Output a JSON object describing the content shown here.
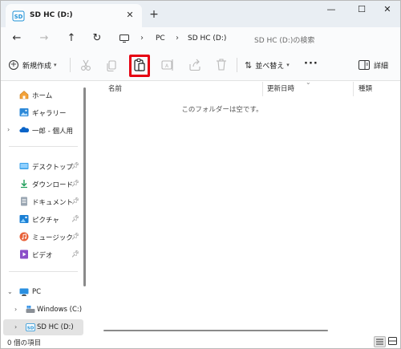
{
  "window": {
    "tab_title": "SD HC (D:)",
    "tab_icon_text": "SD"
  },
  "address_bar": {
    "segments": [
      "PC",
      "SD HC (D:)"
    ],
    "search_placeholder": "SD HC (D:)の検索"
  },
  "command_bar": {
    "new_label": "新規作成",
    "sort_label": "並べ替え",
    "details_label": "詳細"
  },
  "nav_pane": {
    "items": [
      {
        "label": "ホーム",
        "icon": "home-icon"
      },
      {
        "label": "ギャラリー",
        "icon": "gallery-icon"
      },
      {
        "label": "一郎 - 個人用",
        "icon": "onedrive-icon"
      },
      {
        "label": "デスクトップ",
        "icon": "desktop-icon"
      },
      {
        "label": "ダウンロード",
        "icon": "download-icon"
      },
      {
        "label": "ドキュメント",
        "icon": "documents-icon"
      },
      {
        "label": "ピクチャ",
        "icon": "pictures-icon"
      },
      {
        "label": "ミュージック",
        "icon": "music-icon"
      },
      {
        "label": "ビデオ",
        "icon": "videos-icon"
      },
      {
        "label": "PC",
        "icon": "pc-icon"
      },
      {
        "label": "Windows (C:)",
        "icon": "drive-icon"
      },
      {
        "label": "SD HC (D:)",
        "icon": "sd-card-icon"
      }
    ]
  },
  "content": {
    "columns": [
      "名前",
      "更新日時",
      "種類"
    ],
    "empty_message": "このフォルダーは空です。"
  },
  "status_bar": {
    "item_count": "0 個の項目"
  },
  "colors": {
    "highlight": "#e60012",
    "accent": "#0067c0"
  }
}
